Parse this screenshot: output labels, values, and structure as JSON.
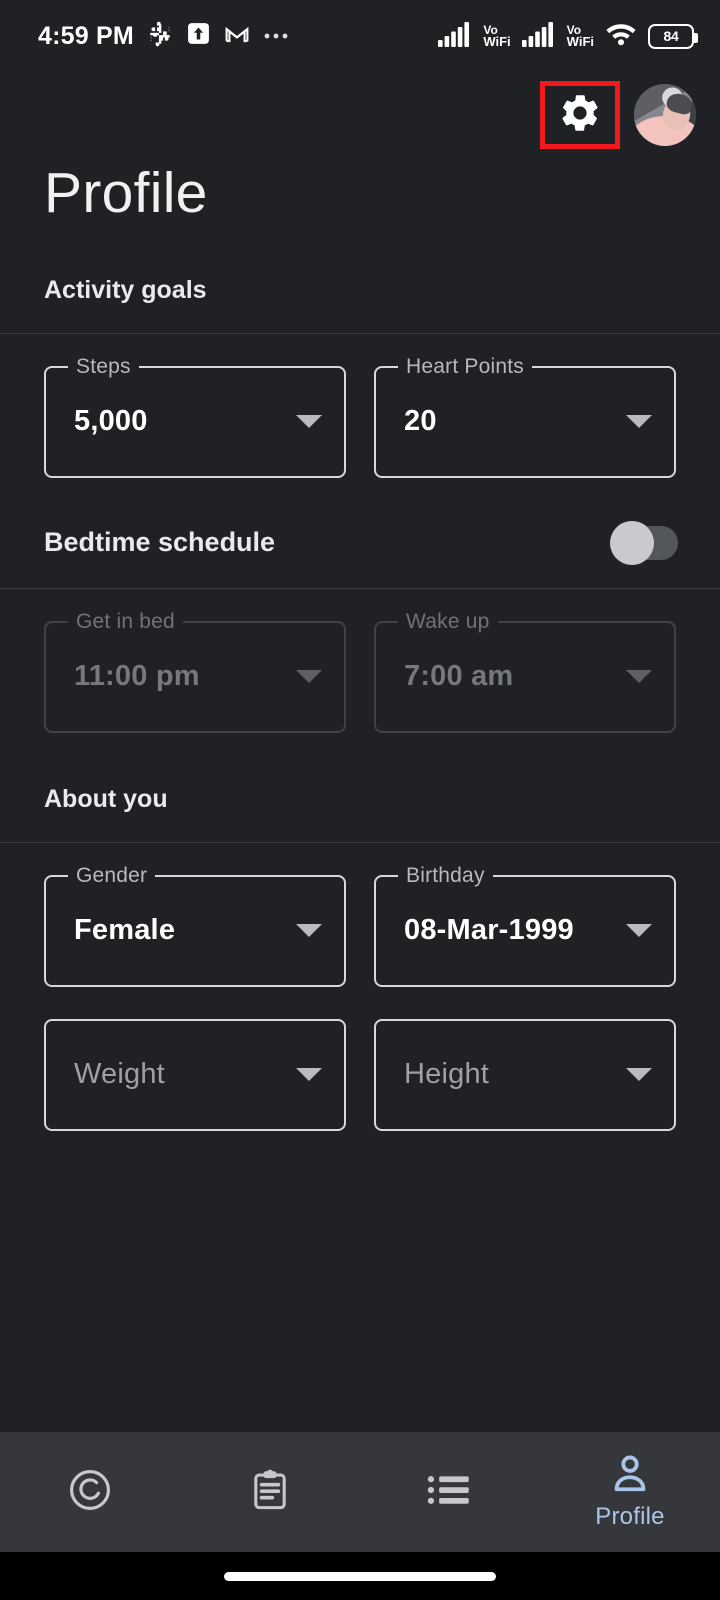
{
  "status_bar": {
    "time": "4:59 PM",
    "left_icons": [
      "slack-icon",
      "upload-arrow-icon",
      "gmail-icon",
      "more-dots-icon"
    ],
    "network": [
      {
        "icon": "signal-bars-icon",
        "label_top": "Vo",
        "label_bottom": "WiFi"
      },
      {
        "icon": "signal-bars-icon",
        "label_top": "Vo",
        "label_bottom": "WiFi"
      }
    ],
    "wifi_icon": "wifi-icon",
    "battery_percent": "84"
  },
  "app_bar": {
    "settings_icon": "gear-icon",
    "avatar_icon": "user-avatar",
    "highlight_color": "#f2191c"
  },
  "page": {
    "title": "Profile"
  },
  "sections": [
    {
      "heading": "Activity goals",
      "fields": [
        {
          "label": "Steps",
          "value": "5,000",
          "disabled": false,
          "is_placeholder": false
        },
        {
          "label": "Heart Points",
          "value": "20",
          "disabled": false,
          "is_placeholder": false
        }
      ]
    },
    {
      "heading": "Bedtime schedule",
      "toggle": {
        "label": "Bedtime schedule",
        "state": "off"
      },
      "fields": [
        {
          "label": "Get in bed",
          "value": "11:00 pm",
          "disabled": true,
          "is_placeholder": false
        },
        {
          "label": "Wake up",
          "value": "7:00 am",
          "disabled": true,
          "is_placeholder": false
        }
      ]
    },
    {
      "heading": "About you",
      "fields": [
        {
          "label": "Gender",
          "value": "Female",
          "disabled": false,
          "is_placeholder": false
        },
        {
          "label": "Birthday",
          "value": "08-Mar-1999",
          "disabled": false,
          "is_placeholder": false
        },
        {
          "label": "",
          "value": "Weight",
          "disabled": false,
          "is_placeholder": true
        },
        {
          "label": "",
          "value": "Height",
          "disabled": false,
          "is_placeholder": true
        }
      ]
    }
  ],
  "bottom_nav": {
    "items": [
      {
        "icon": "activity-ring-icon",
        "label": "",
        "active": false
      },
      {
        "icon": "clipboard-icon",
        "label": "",
        "active": false
      },
      {
        "icon": "bulleted-list-icon",
        "label": "",
        "active": false
      },
      {
        "icon": "person-icon",
        "label": "Profile",
        "active": true
      }
    ],
    "active_color": "#aac5ea",
    "inactive_color": "#c6c8cc"
  }
}
